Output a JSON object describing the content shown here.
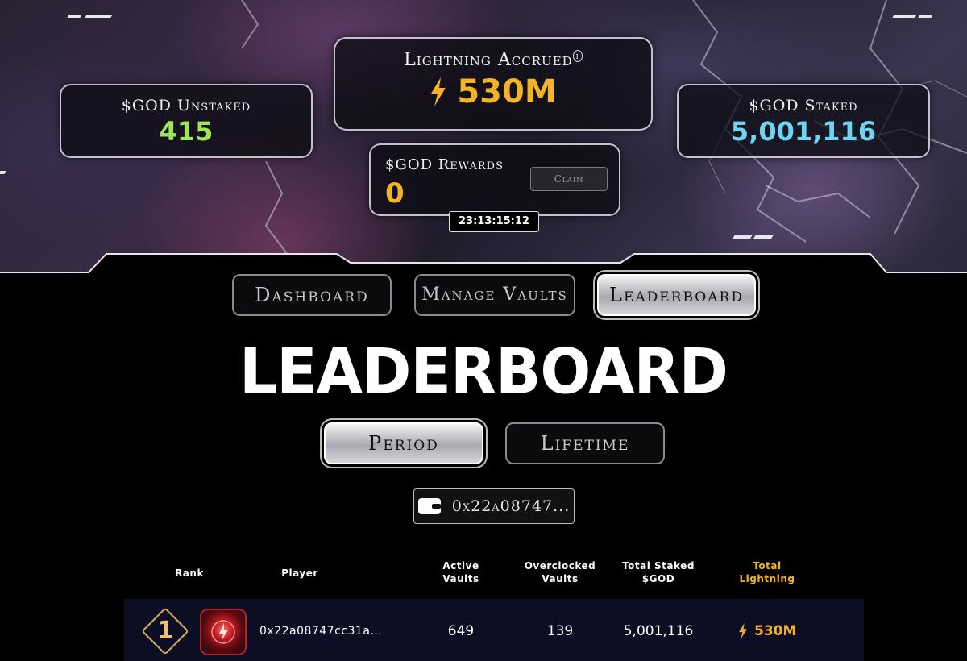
{
  "stats": {
    "unstaked_label": "$GOD Unstaked",
    "unstaked_value": "415",
    "staked_label": "$GOD Staked",
    "staked_value": "5,001,116",
    "lightning_label": "Lightning Accrued",
    "lightning_info": "i",
    "lightning_value": "530M",
    "rewards_label": "$GOD Rewards",
    "rewards_value": "0",
    "claim_label": "Claim",
    "timer": "23:13:15:12"
  },
  "nav": {
    "dashboard": "Dashboard",
    "manage_vaults": "Manage Vaults",
    "leaderboard": "Leaderboard"
  },
  "page_title": "LEADERBOARD",
  "period_tabs": {
    "period": "Period",
    "lifetime": "Lifetime"
  },
  "wallet": {
    "label": "0x22a08747..."
  },
  "table": {
    "headers": {
      "rank": "Rank",
      "player": "Player",
      "active_vaults_1": "Active",
      "active_vaults_2": "Vaults",
      "overclocked_1": "Overclocked",
      "overclocked_2": "Vaults",
      "total_staked_1": "Total Staked",
      "total_staked_2": "$GOD",
      "total_lightning_1": "Total",
      "total_lightning_2": "Lightning"
    },
    "rows": [
      {
        "rank": "1",
        "player": "0x22a08747cc31a...",
        "active_vaults": "649",
        "overclocked_vaults": "139",
        "total_staked": "5,001,116",
        "total_lightning": "530M"
      }
    ]
  },
  "colors": {
    "unstaked": "#9fe55a",
    "staked": "#6fd4ef",
    "gold": "#f3b324"
  }
}
